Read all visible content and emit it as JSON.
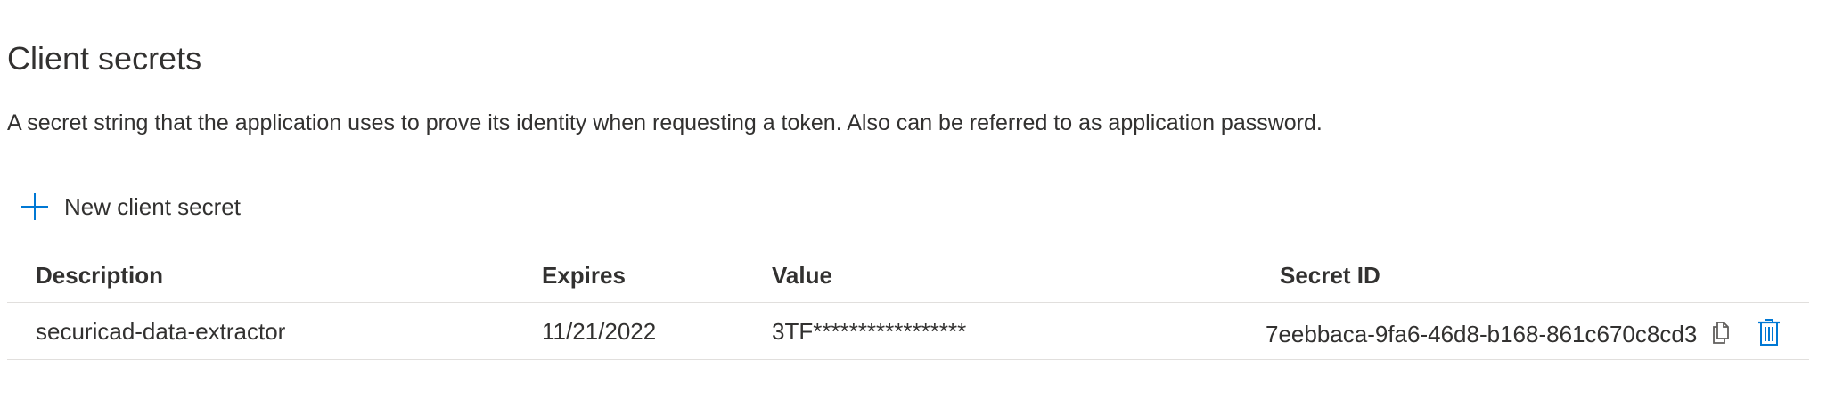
{
  "section": {
    "title": "Client secrets",
    "description": "A secret string that the application uses to prove its identity when requesting a token. Also can be referred to as application password."
  },
  "toolbar": {
    "new_secret_label": "New client secret",
    "new_secret_icon": "plus-icon"
  },
  "table": {
    "columns": [
      "Description",
      "Expires",
      "Value",
      "Secret ID"
    ],
    "rows": [
      {
        "description": "securicad-data-extractor",
        "expires": "11/21/2022",
        "value": "3TF*****************",
        "secret_id": "7eebbaca-9fa6-46d8-b168-861c670c8cd3",
        "actions": [
          "copy-icon",
          "delete-icon"
        ]
      }
    ]
  },
  "colors": {
    "accent": "#0078d4",
    "text": "#323130",
    "border": "#e1dfdd",
    "icon_gray": "#605e5c"
  }
}
